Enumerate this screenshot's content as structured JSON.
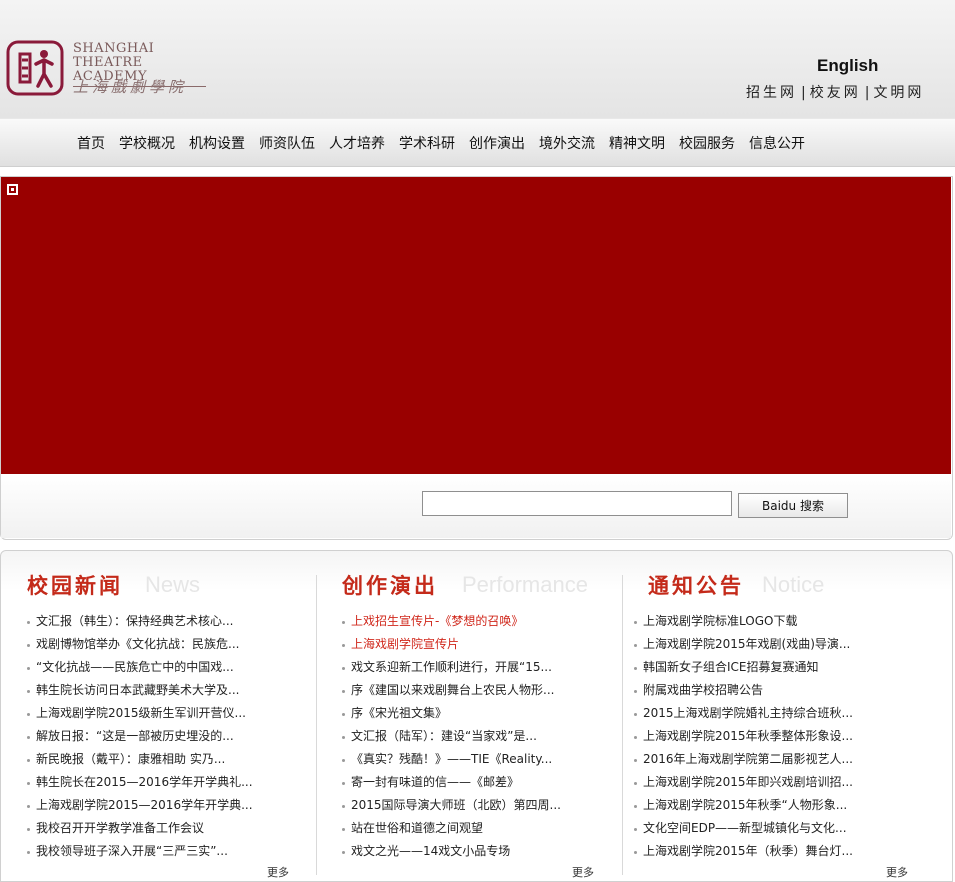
{
  "header": {
    "logo_en_line1": "SHANGHAI",
    "logo_en_line2": "THEATRE ACADEMY",
    "logo_cn": "上海戲劇學院",
    "lang_link": "English",
    "toplinks": [
      "招生网",
      "校友网",
      "文明网"
    ],
    "toplinks_sep": "|"
  },
  "nav": {
    "items": [
      "首页",
      "学校概况",
      "机构设置",
      "师资队伍",
      "人才培养",
      "学术科研",
      "创作演出",
      "境外交流",
      "精神文明",
      "校园服务",
      "信息公开"
    ]
  },
  "banner": {
    "color": "#990000"
  },
  "search": {
    "value": "",
    "button_label": "Baidu 搜索"
  },
  "columns": [
    {
      "title_cn": "校园新闻",
      "title_en": "News",
      "items": [
        {
          "text": "文汇报（韩生）：保持经典艺术核心...",
          "hot": false
        },
        {
          "text": "戏剧博物馆举办《文化抗战：民族危...",
          "hot": false
        },
        {
          "text": "“文化抗战——民族危亡中的中国戏...",
          "hot": false
        },
        {
          "text": "韩生院长访问日本武藏野美术大学及...",
          "hot": false
        },
        {
          "text": "上海戏剧学院2015级新生军训开营仪...",
          "hot": false
        },
        {
          "text": "解放日报：“这是一部被历史埋没的...",
          "hot": false
        },
        {
          "text": "新民晚报（戴平）：康雅相助 实乃...",
          "hot": false
        },
        {
          "text": "韩生院长在2015—2016学年开学典礼...",
          "hot": false
        },
        {
          "text": "上海戏剧学院2015—2016学年开学典...",
          "hot": false
        },
        {
          "text": "我校召开开学教学准备工作会议",
          "hot": false
        },
        {
          "text": "我校领导班子深入开展“三严三实”...",
          "hot": false
        }
      ],
      "more": "更多"
    },
    {
      "title_cn": "创作演出",
      "title_en": "Performance",
      "items": [
        {
          "text": "上戏招生宣传片-《梦想的召唤》",
          "hot": true
        },
        {
          "text": "上海戏剧学院宣传片",
          "hot": true
        },
        {
          "text": "戏文系迎新工作顺利进行，开展“15...",
          "hot": false
        },
        {
          "text": "序《建国以来戏剧舞台上农民人物形...",
          "hot": false
        },
        {
          "text": "序《宋光祖文集》",
          "hot": false
        },
        {
          "text": "文汇报（陆军）：建设“当家戏”是...",
          "hot": false
        },
        {
          "text": "《真实？残酷！》——TIE《Reality...",
          "hot": false
        },
        {
          "text": "寄一封有味道的信——《邮差》",
          "hot": false
        },
        {
          "text": "2015国际导演大师班（北欧）第四周...",
          "hot": false
        },
        {
          "text": "站在世俗和道德之间观望",
          "hot": false
        },
        {
          "text": "戏文之光——14戏文小品专场",
          "hot": false
        }
      ],
      "more": "更多"
    },
    {
      "title_cn": "通知公告",
      "title_en": "Notice",
      "items": [
        {
          "text": "上海戏剧学院标准LOGO下载",
          "hot": false
        },
        {
          "text": "上海戏剧学院2015年戏剧(戏曲)导演...",
          "hot": false
        },
        {
          "text": "韩国新女子组合ICE招募复赛通知",
          "hot": false
        },
        {
          "text": "附属戏曲学校招聘公告",
          "hot": false
        },
        {
          "text": "2015上海戏剧学院婚礼主持综合班秋...",
          "hot": false
        },
        {
          "text": "上海戏剧学院2015年秋季整体形象设...",
          "hot": false
        },
        {
          "text": "2016年上海戏剧学院第二届影视艺人...",
          "hot": false
        },
        {
          "text": "上海戏剧学院2015年即兴戏剧培训招...",
          "hot": false
        },
        {
          "text": "上海戏剧学院2015年秋季“人物形象...",
          "hot": false
        },
        {
          "text": "文化空间EDP——新型城镇化与文化...",
          "hot": false
        },
        {
          "text": "上海戏剧学院2015年（秋季）舞台灯...",
          "hot": false
        }
      ],
      "more": "更多"
    }
  ]
}
